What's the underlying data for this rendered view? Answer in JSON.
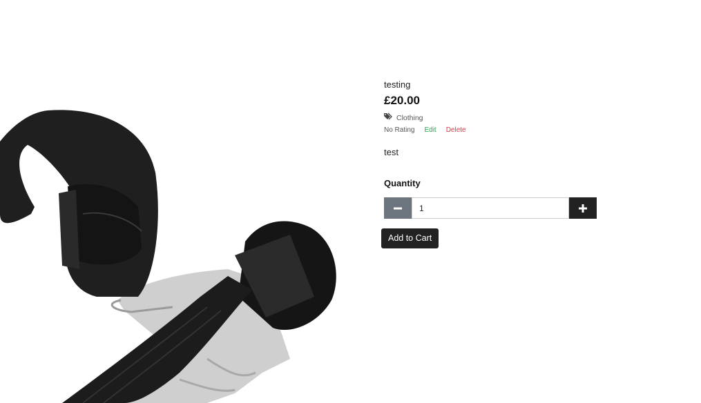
{
  "product": {
    "name": "testing",
    "price": "£20.00",
    "category": "Clothing",
    "rating": "No Rating",
    "edit_label": "Edit",
    "delete_label": "Delete",
    "description": "test",
    "image_icon": "lifting-straps-image"
  },
  "quantity": {
    "label": "Quantity",
    "value": "1",
    "minus_icon": "minus-icon",
    "plus_icon": "plus-icon"
  },
  "actions": {
    "add_to_cart_label": "Add to Cart"
  },
  "colors": {
    "edit": "#28a745",
    "delete": "#dc3545",
    "button_dark": "#222222",
    "button_gray": "#6c757d"
  }
}
